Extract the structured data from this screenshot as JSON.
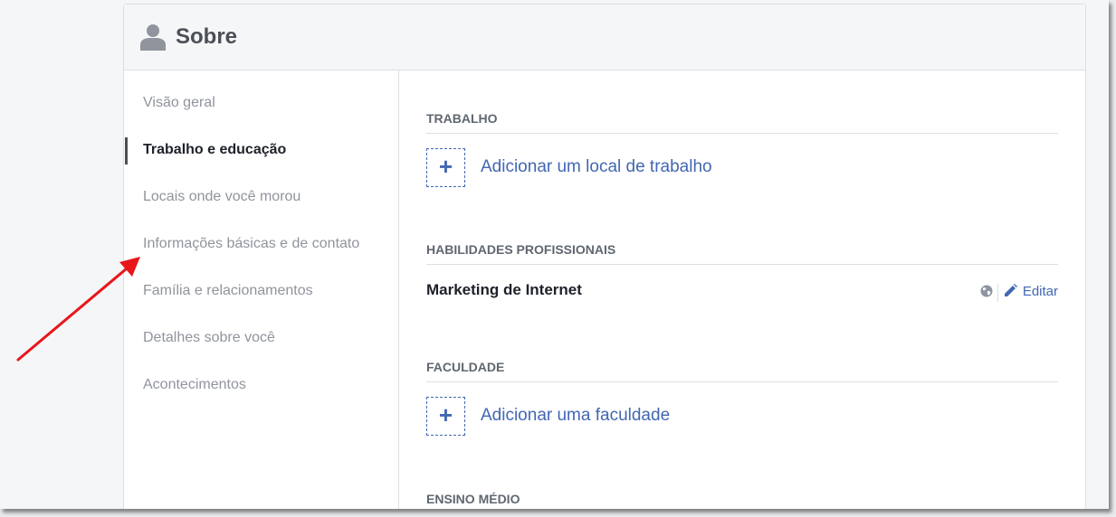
{
  "header": {
    "icon": "user-silhouette-icon",
    "title": "Sobre"
  },
  "sidebar": {
    "items": [
      {
        "label": "Visão geral",
        "active": false
      },
      {
        "label": "Trabalho e educação",
        "active": true
      },
      {
        "label": "Locais onde você morou",
        "active": false
      },
      {
        "label": "Informações básicas e de contato",
        "active": false
      },
      {
        "label": "Família e relacionamentos",
        "active": false
      },
      {
        "label": "Detalhes sobre você",
        "active": false
      },
      {
        "label": "Acontecimentos",
        "active": false
      }
    ]
  },
  "content": {
    "work": {
      "title": "TRABALHO",
      "add_label": "Adicionar um local de trabalho",
      "add_icon": "plus-icon"
    },
    "skills": {
      "title": "HABILIDADES PROFISSIONAIS",
      "item": "Marketing de Internet",
      "privacy_icon": "globe-icon",
      "edit_icon": "pencil-icon",
      "edit_label": "Editar"
    },
    "college": {
      "title": "FACULDADE",
      "add_label": "Adicionar uma faculdade",
      "add_icon": "plus-icon"
    },
    "high_school": {
      "title": "ENSINO MÉDIO"
    }
  },
  "annotation": {
    "icon": "red-arrow-icon",
    "color": "#e8161b"
  },
  "colors": {
    "link": "#4267b2",
    "muted_text": "#90949c",
    "border": "#dddfe2",
    "header_background": "#f5f6f7"
  }
}
